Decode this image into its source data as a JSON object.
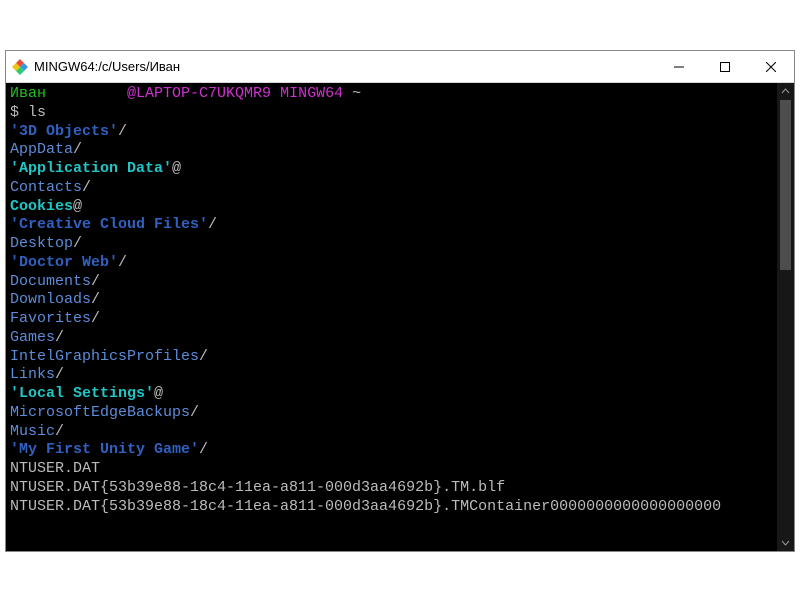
{
  "window": {
    "title": "MINGW64:/c/Users/Иван"
  },
  "prompt": {
    "user": "Иван",
    "at_host": "@LAPTOP-C7UKQMR9",
    "env": "MINGW64",
    "cwd": "~",
    "ps1": "$",
    "command": "ls"
  },
  "ls": {
    "items": [
      {
        "text": "'3D Objects'",
        "cls": "c-bold-d",
        "suffix": "/"
      },
      {
        "text": "AppData",
        "cls": "c-dir",
        "suffix": "/"
      },
      {
        "text": "'Application Data'",
        "cls": "c-cy-b",
        "suffix": "@"
      },
      {
        "text": "Contacts",
        "cls": "c-dir",
        "suffix": "/"
      },
      {
        "text": "Cookies",
        "cls": "c-cy-b",
        "suffix": "@"
      },
      {
        "text": "'Creative Cloud Files'",
        "cls": "c-bold-d",
        "suffix": "/"
      },
      {
        "text": "Desktop",
        "cls": "c-dir",
        "suffix": "/"
      },
      {
        "text": "'Doctor Web'",
        "cls": "c-bold-d",
        "suffix": "/"
      },
      {
        "text": "Documents",
        "cls": "c-dir",
        "suffix": "/"
      },
      {
        "text": "Downloads",
        "cls": "c-dir",
        "suffix": "/"
      },
      {
        "text": "Favorites",
        "cls": "c-dir",
        "suffix": "/"
      },
      {
        "text": "Games",
        "cls": "c-dir",
        "suffix": "/"
      },
      {
        "text": "IntelGraphicsProfiles",
        "cls": "c-dir",
        "suffix": "/"
      },
      {
        "text": "Links",
        "cls": "c-dir",
        "suffix": "/"
      },
      {
        "text": "'Local Settings'",
        "cls": "c-cy-b",
        "suffix": "@"
      },
      {
        "text": "MicrosoftEdgeBackups",
        "cls": "c-dir",
        "suffix": "/"
      },
      {
        "text": "Music",
        "cls": "c-dir",
        "suffix": "/"
      },
      {
        "text": "'My First Unity Game'",
        "cls": "c-bold-d",
        "suffix": "/"
      },
      {
        "text": "NTUSER.DAT",
        "cls": "c-gray",
        "suffix": ""
      },
      {
        "text": "NTUSER.DAT{53b39e88-18c4-11ea-a811-000d3aa4692b}.TM.blf",
        "cls": "c-gray",
        "suffix": ""
      },
      {
        "text": "NTUSER.DAT{53b39e88-18c4-11ea-a811-000d3aa4692b}.TMContainer0000000000000000000",
        "cls": "c-gray",
        "suffix": ""
      }
    ]
  }
}
